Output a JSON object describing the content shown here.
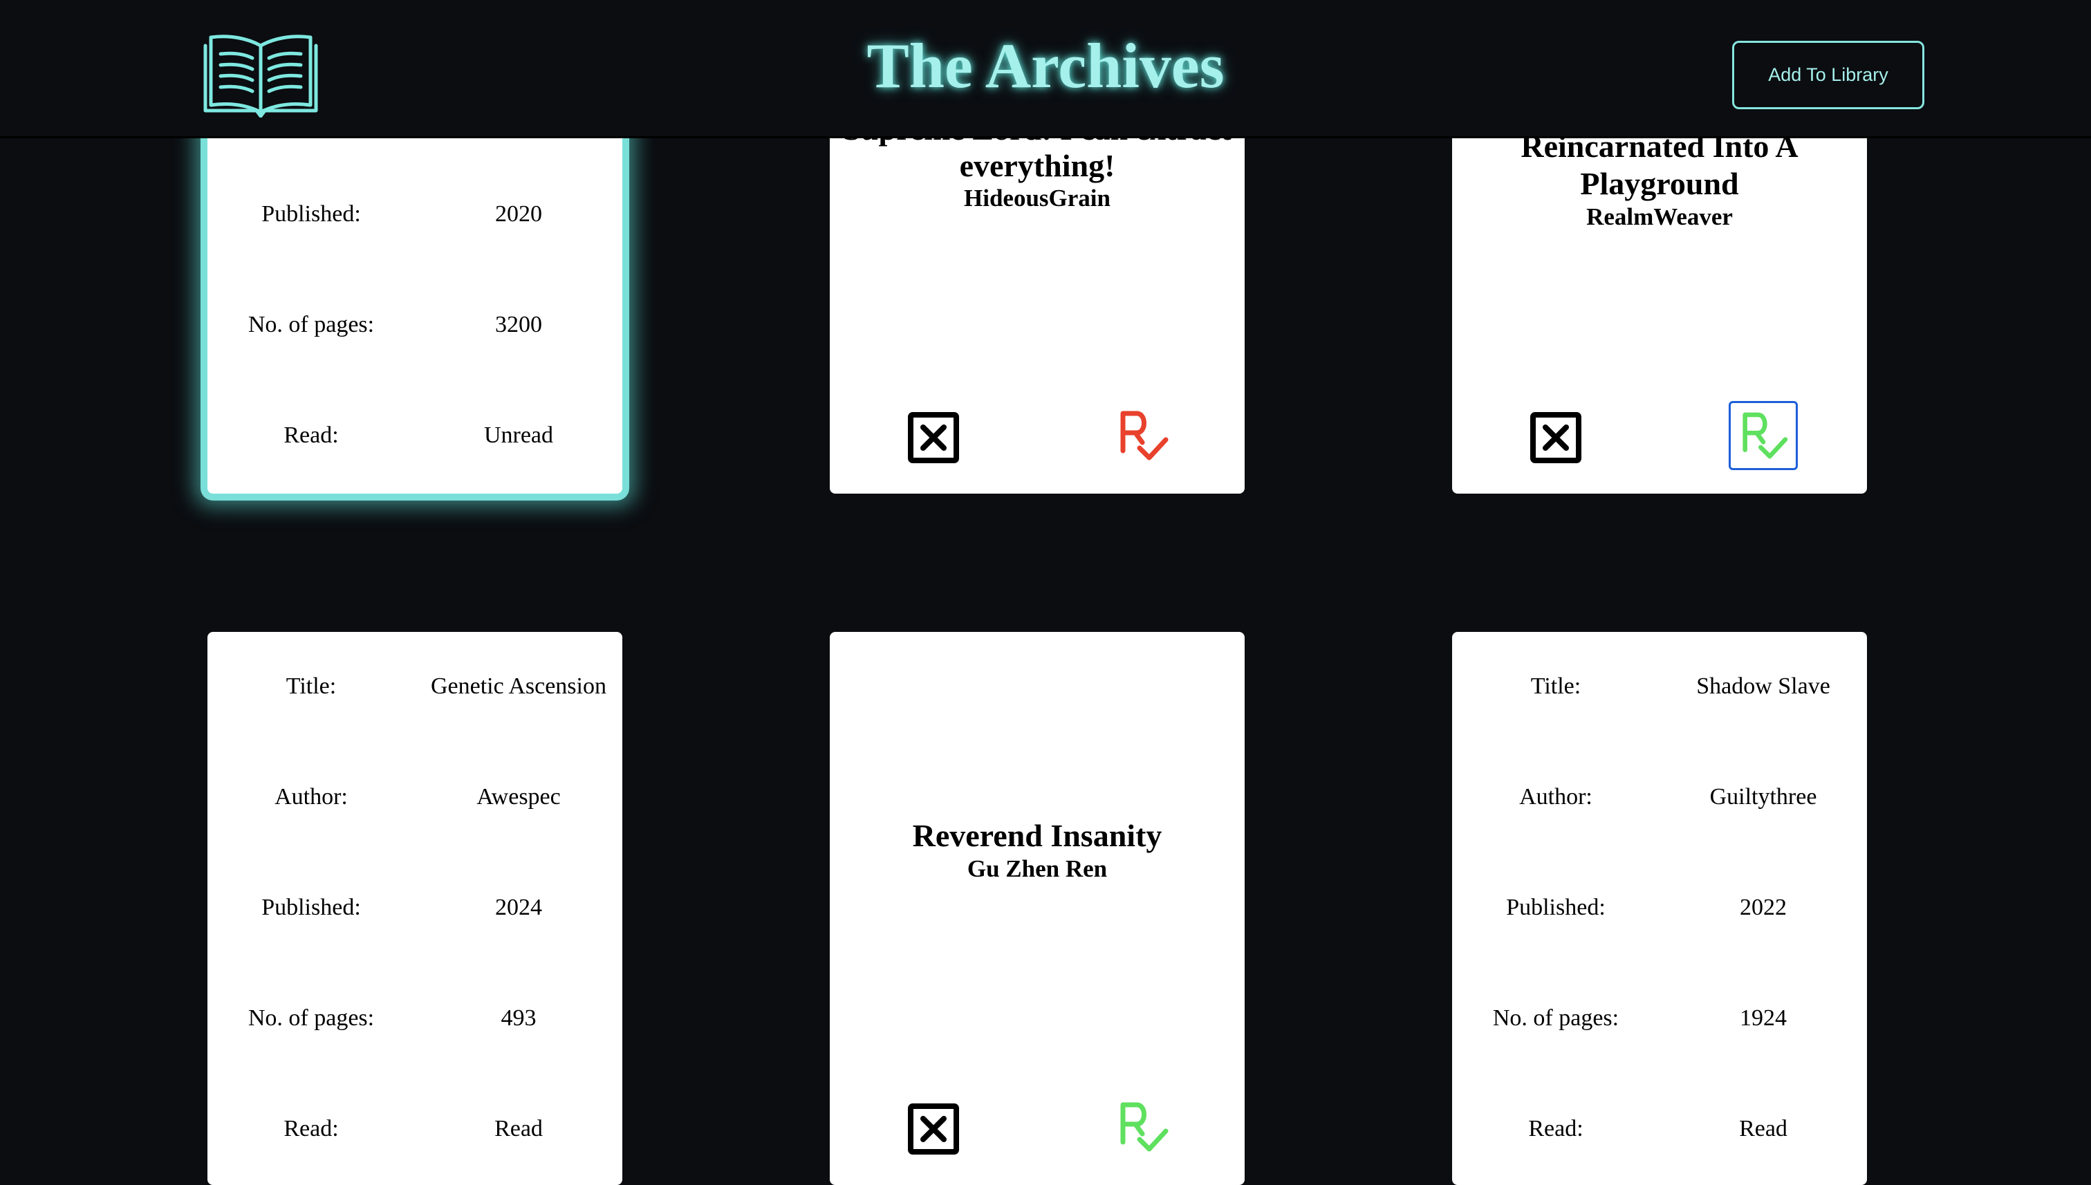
{
  "header": {
    "title": "The Archives",
    "add_button_label": "Add To Library",
    "logo_icon": "open-book-icon"
  },
  "colors": {
    "background": "#0b0d11",
    "accent": "#a6f0ec",
    "glow": "#62e6dc",
    "read_mark_unread": "#e8412c",
    "read_mark_read": "#5fe05f",
    "focus_outline": "#1d5fd8"
  },
  "cards": [
    {
      "view": "details",
      "highlighted": true,
      "fields": [
        {
          "label": "Published:",
          "value": "2020"
        },
        {
          "label": "No. of pages:",
          "value": "3200"
        },
        {
          "label": "Read:",
          "value": "Unread"
        }
      ]
    },
    {
      "view": "front",
      "title_line_partial": "Supreme Lord: I can extract",
      "title_line": "everything!",
      "author": "HideousGrain",
      "read_icon": "read-check-icon",
      "read_state": "unread"
    },
    {
      "view": "front",
      "title_line_partial": "Reincarnated Into A",
      "title_line": "Playground",
      "author": "RealmWeaver",
      "read_icon": "read-check-icon",
      "read_state": "read"
    },
    {
      "view": "details",
      "fields": [
        {
          "label": "Title:",
          "value": "Genetic Ascension"
        },
        {
          "label": "Author:",
          "value": "Awespec"
        },
        {
          "label": "Published:",
          "value": "2024"
        },
        {
          "label": "No. of pages:",
          "value": "493"
        },
        {
          "label": "Read:",
          "value": "Read"
        }
      ]
    },
    {
      "view": "front",
      "title_line": "Reverend Insanity",
      "author": "Gu Zhen Ren",
      "read_icon": "read-check-icon",
      "read_state": "read"
    },
    {
      "view": "details",
      "fields": [
        {
          "label": "Title:",
          "value": "Shadow Slave"
        },
        {
          "label": "Author:",
          "value": "Guiltythree"
        },
        {
          "label": "Published:",
          "value": "2022"
        },
        {
          "label": "No. of pages:",
          "value": "1924"
        },
        {
          "label": "Read:",
          "value": "Read"
        }
      ]
    }
  ]
}
